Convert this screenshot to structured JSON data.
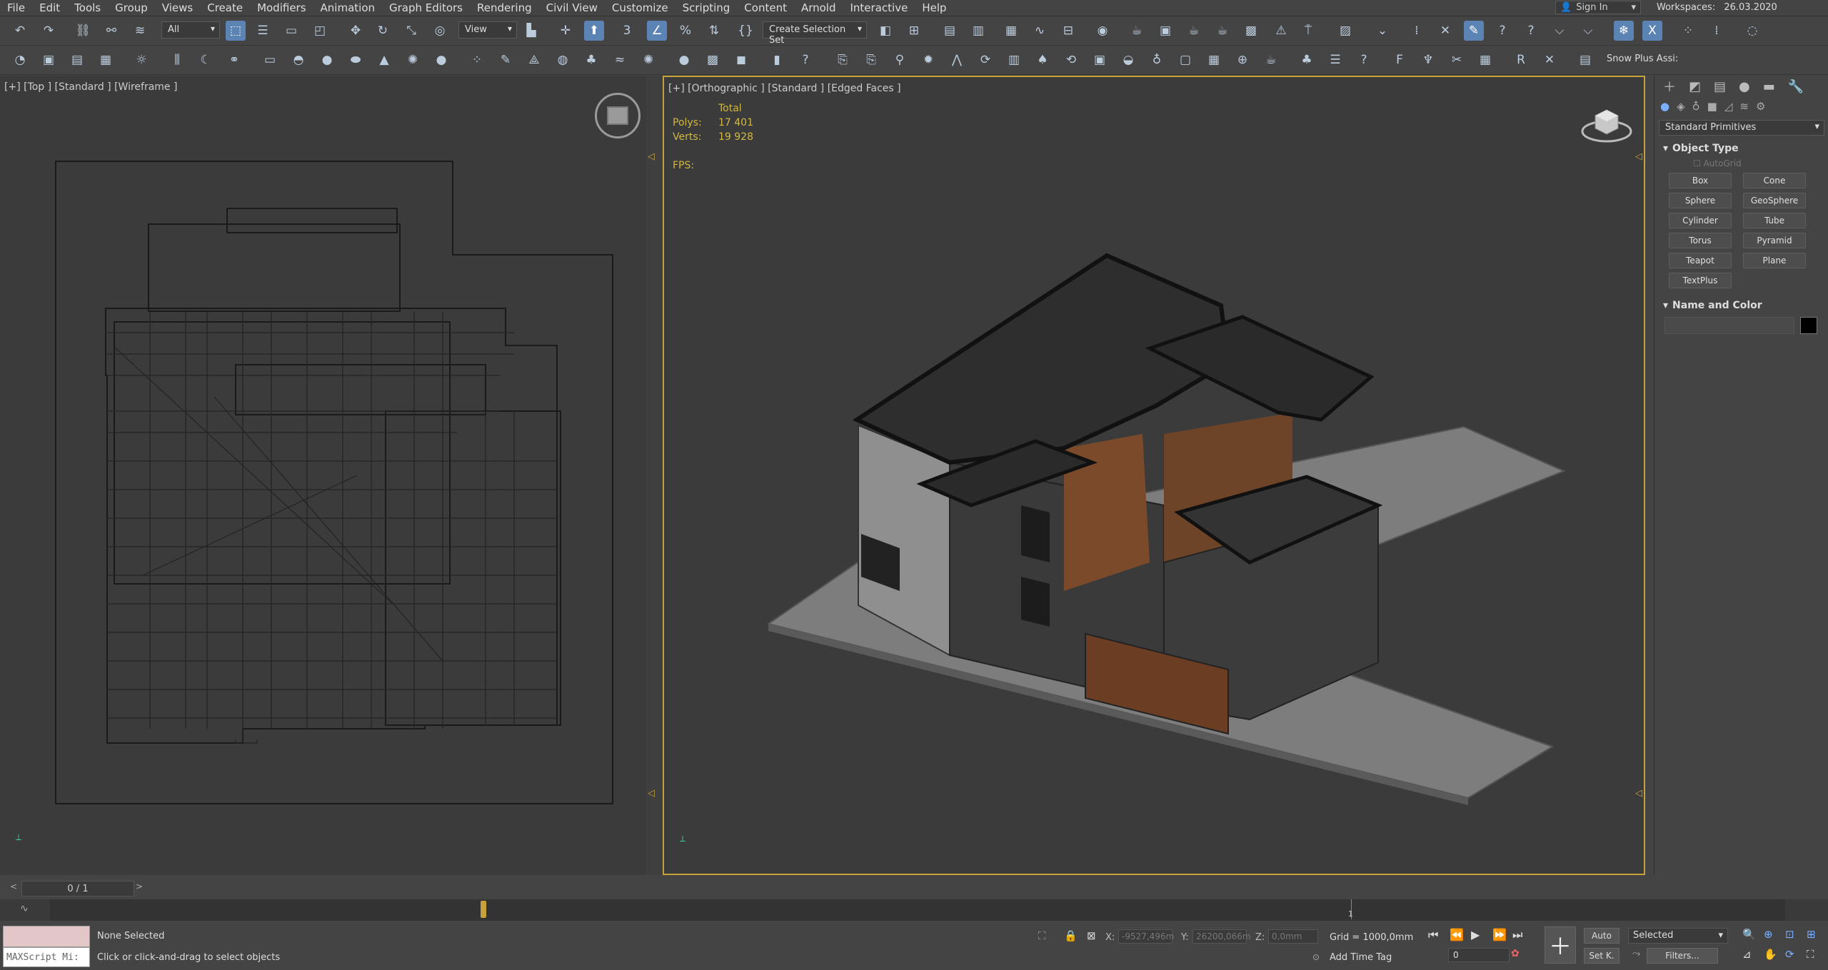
{
  "menu": [
    "File",
    "Edit",
    "Tools",
    "Group",
    "Views",
    "Create",
    "Modifiers",
    "Animation",
    "Graph Editors",
    "Rendering",
    "Civil View",
    "Customize",
    "Scripting",
    "Content",
    "Arnold",
    "Interactive",
    "Help"
  ],
  "account": {
    "signin_label": "Sign In",
    "workspaces_label": "Workspaces:",
    "workspace_value": "26.03.2020"
  },
  "toolbar": {
    "filter_value": "All",
    "refcoord_value": "View",
    "selection_set_placeholder": "Create Selection Set",
    "snow_label": "Snow Plus Assi:"
  },
  "viewports": {
    "left_label": "[+] [Top ] [Standard ] [Wireframe ]",
    "right_label": "[+] [Orthographic ] [Standard ] [Edged Faces ]",
    "stats": {
      "total_label": "Total",
      "polys_label": "Polys:",
      "polys_value": "17 401",
      "verts_label": "Verts:",
      "verts_value": "19 928",
      "fps_label": "FPS:"
    }
  },
  "command_panel": {
    "category_value": "Standard Primitives",
    "object_type_title": "Object Type",
    "autogrid_label": "AutoGrid",
    "primitives": [
      "Box",
      "Cone",
      "Sphere",
      "GeoSphere",
      "Cylinder",
      "Tube",
      "Torus",
      "Pyramid",
      "Teapot",
      "Plane",
      "TextPlus"
    ],
    "name_color_title": "Name and Color",
    "object_color": "#000000"
  },
  "timeline": {
    "frame_display": "0 / 1",
    "tick_label": "1",
    "current_frame_fraction": 0
  },
  "status": {
    "maxscript_label": "MAXScript Mi:",
    "selection_text": "None Selected",
    "prompt_text": "Click or click-and-drag to select objects",
    "x_label": "X:",
    "x_value": "-9527,496m",
    "y_label": "Y:",
    "y_value": "26200,066m",
    "z_label": "Z:",
    "z_value": "0,0mm",
    "grid_text": "Grid = 1000,0mm",
    "add_time_tag": "Add Time Tag",
    "auto_label": "Auto",
    "setkey_label": "Set K.",
    "selected_value": "Selected",
    "filters_label": "Filters...",
    "frame_value": "0"
  },
  "colors": {
    "viewport_active_border": "#c7a13a",
    "stats_text": "#d1b843",
    "active_button": "#5b84b4"
  }
}
